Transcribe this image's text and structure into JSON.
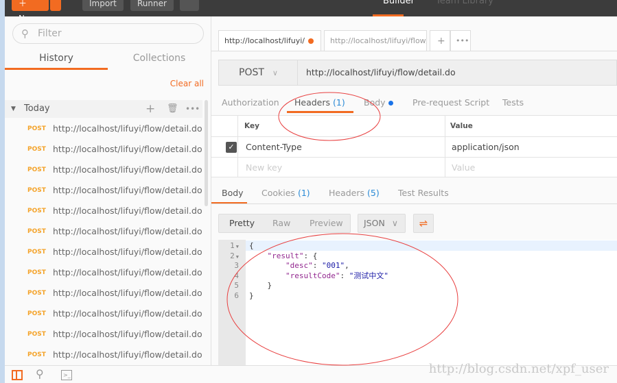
{
  "topbar": {
    "new_label": "New",
    "import_label": "Import",
    "runner_label": "Runner",
    "builder_label": "Builder",
    "team_library_label": "Team Library",
    "accent": "#f26b21"
  },
  "sidebar": {
    "filter_placeholder": "Filter",
    "tabs": [
      "History",
      "Collections"
    ],
    "clear_all": "Clear all",
    "group": "Today",
    "items": [
      {
        "method": "POST",
        "url": "http://localhost/lifuyi/flow/detail.do"
      },
      {
        "method": "POST",
        "url": "http://localhost/lifuyi/flow/detail.do"
      },
      {
        "method": "POST",
        "url": "http://localhost/lifuyi/flow/detail.do"
      },
      {
        "method": "POST",
        "url": "http://localhost/lifuyi/flow/detail.do"
      },
      {
        "method": "POST",
        "url": "http://localhost/lifuyi/flow/detail.do"
      },
      {
        "method": "POST",
        "url": "http://localhost/lifuyi/flow/detail.do"
      },
      {
        "method": "POST",
        "url": "http://localhost/lifuyi/flow/detail.do"
      },
      {
        "method": "POST",
        "url": "http://localhost/lifuyi/flow/detail.do"
      },
      {
        "method": "POST",
        "url": "http://localhost/lifuyi/flow/detail.do"
      },
      {
        "method": "POST",
        "url": "http://localhost/lifuyi/flow/detail.do"
      },
      {
        "method": "POST",
        "url": "http://localhost/lifuyi/flow/detail.do"
      },
      {
        "method": "POST",
        "url": "http://localhost/lifuyi/flow/detail.do"
      }
    ]
  },
  "request_tabs": [
    "http://localhost/lifuyi/",
    "http://localhost/lifuyi/flow/c"
  ],
  "request": {
    "method": "POST",
    "url": "http://localhost/lifuyi/flow/detail.do"
  },
  "subtabs": {
    "authorization": "Authorization",
    "headers": "Headers",
    "headers_count": "(1)",
    "body": "Body",
    "prerequest": "Pre-request Script",
    "tests": "Tests"
  },
  "headers_table": {
    "key_col": "Key",
    "value_col": "Value",
    "rows": [
      {
        "key": "Content-Type",
        "value": "application/json",
        "checked": true
      }
    ],
    "new_key_placeholder": "New key",
    "new_value_placeholder": "Value"
  },
  "response": {
    "tabs": {
      "body": "Body",
      "cookies": "Cookies",
      "cookies_count": "(1)",
      "headers": "Headers",
      "headers_count": "(5)",
      "test_results": "Test Results"
    },
    "views": [
      "Pretty",
      "Raw",
      "Preview"
    ],
    "format": "JSON"
  },
  "code_lines": [
    {
      "n": "1",
      "fold": true,
      "parts": [
        [
          "p",
          "{"
        ]
      ]
    },
    {
      "n": "2",
      "fold": true,
      "parts": [
        [
          "p",
          "    "
        ],
        [
          "k",
          "\"result\""
        ],
        [
          "p",
          ": {"
        ]
      ]
    },
    {
      "n": "3",
      "fold": false,
      "parts": [
        [
          "p",
          "        "
        ],
        [
          "k",
          "\"desc\""
        ],
        [
          "p",
          ": "
        ],
        [
          "s",
          "\"001\""
        ],
        [
          "p",
          ","
        ]
      ]
    },
    {
      "n": "4",
      "fold": false,
      "parts": [
        [
          "p",
          "        "
        ],
        [
          "k",
          "\"resultCode\""
        ],
        [
          "p",
          ": "
        ],
        [
          "s",
          "\"测试中文\""
        ]
      ]
    },
    {
      "n": "5",
      "fold": false,
      "parts": [
        [
          "p",
          "    }"
        ]
      ]
    },
    {
      "n": "6",
      "fold": false,
      "parts": [
        [
          "p",
          "}"
        ]
      ]
    }
  ],
  "watermark": "http://blog.csdn.net/xpf_user"
}
